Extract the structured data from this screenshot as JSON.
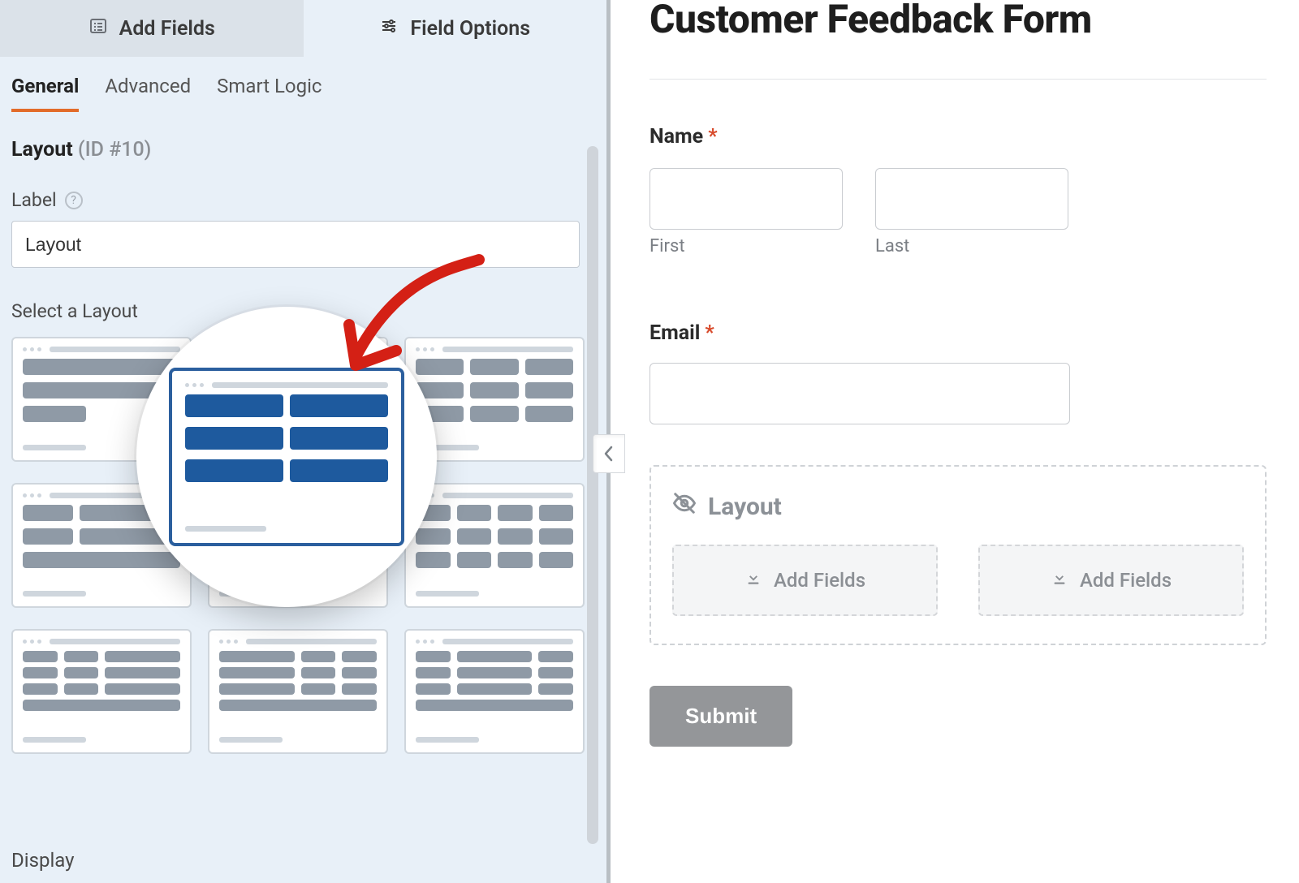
{
  "topTabs": {
    "addFields": "Add Fields",
    "fieldOptions": "Field Options"
  },
  "subTabs": {
    "general": "General",
    "advanced": "Advanced",
    "smartLogic": "Smart Logic"
  },
  "section": {
    "title": "Layout",
    "idText": "(ID #10)"
  },
  "labelField": {
    "label": "Label",
    "value": "Layout"
  },
  "selectLayoutLabel": "Select a Layout",
  "displayLabel": "Display",
  "preview": {
    "formTitle": "Customer Feedback Form",
    "nameLabel": "Name",
    "firstSub": "First",
    "lastSub": "Last",
    "emailLabel": "Email",
    "layoutBlockTitle": "Layout",
    "addFieldsText": "Add Fields",
    "submitLabel": "Submit"
  }
}
